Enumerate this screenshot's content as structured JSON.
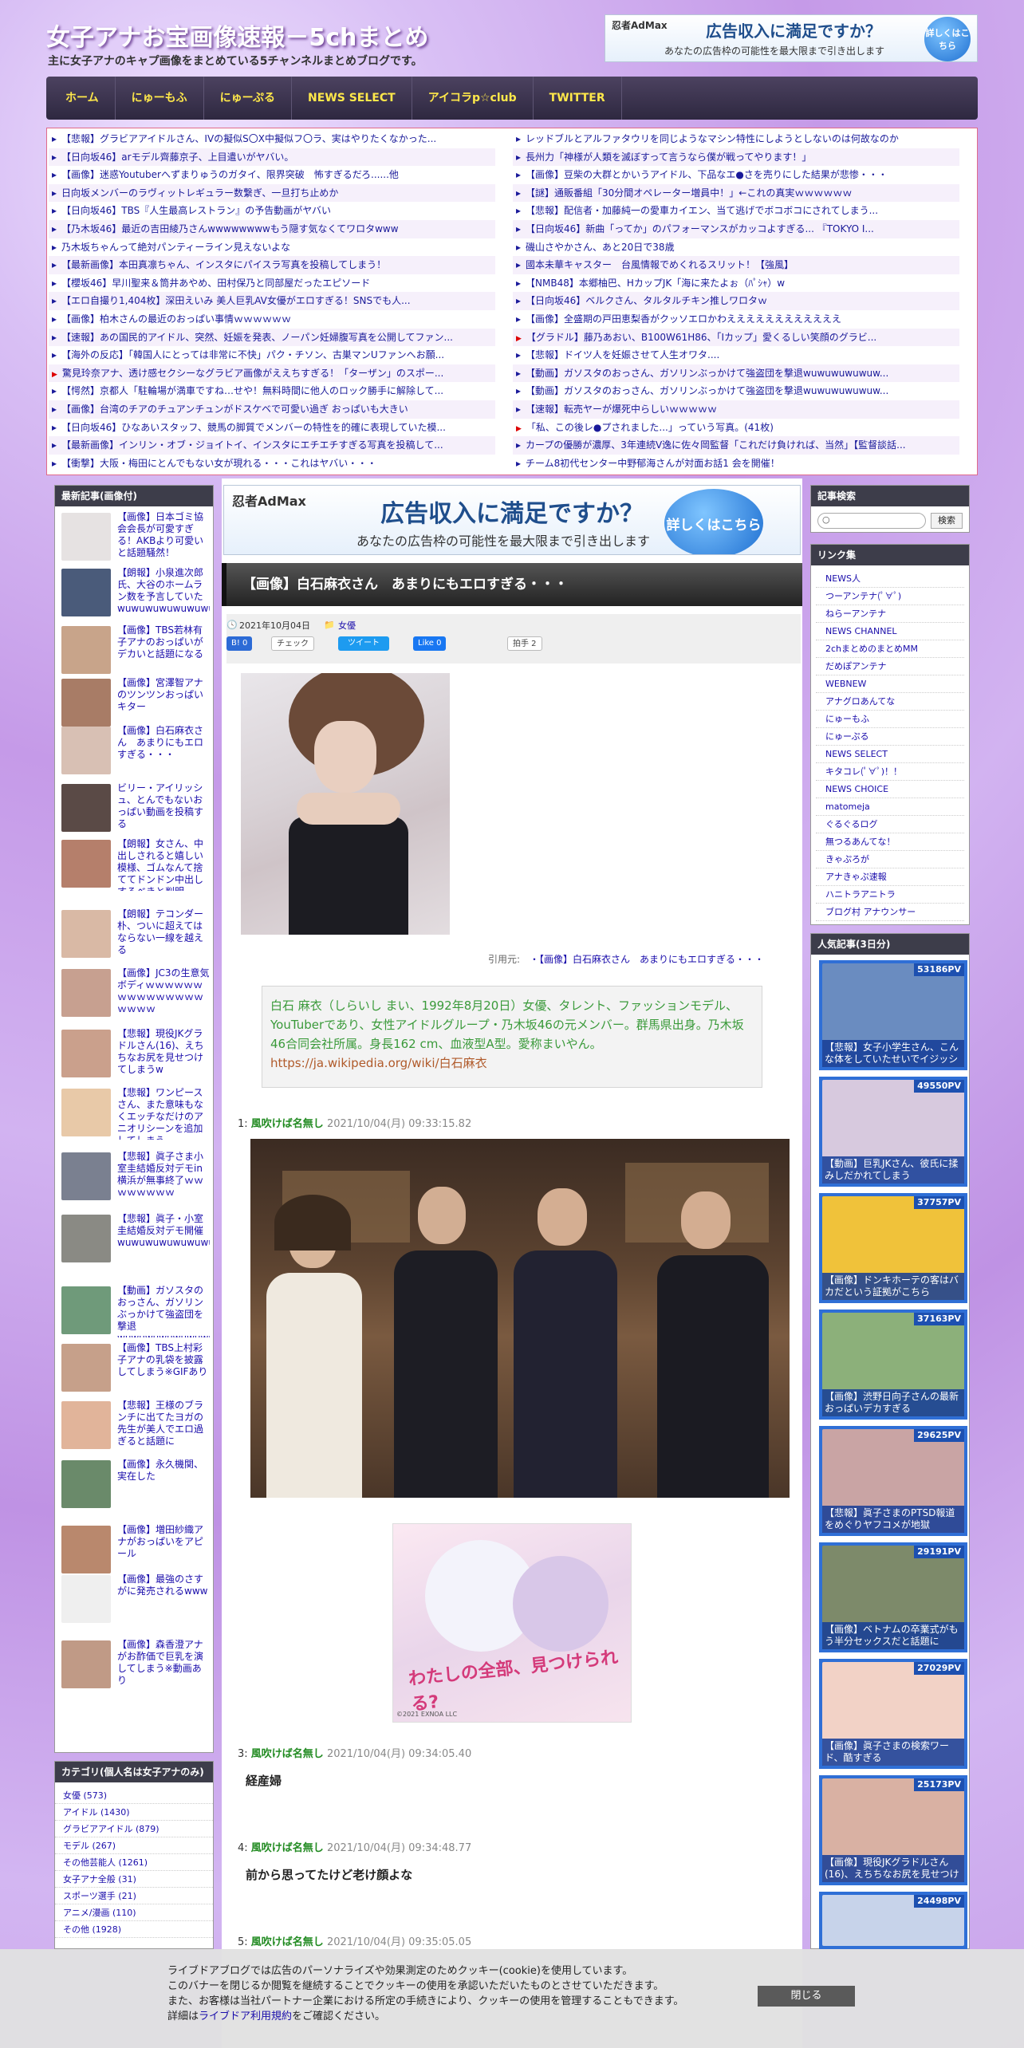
{
  "header": {
    "title": "女子アナお宝画像速報－5chまとめ",
    "subtitle": "主に女子アナのキャプ画像をまとめている5チャンネルまとめブログです。"
  },
  "ad_top": {
    "brand": "忍者AdMax",
    "headline": "広告収入に満足ですか？",
    "sub": "あなたの広告枠の可能性を最大限まで引き出します",
    "button": "詳しくはこちら"
  },
  "nav": [
    "ホーム",
    "にゅーもふ",
    "にゅーぷる",
    "NEWS SELECT",
    "アイコラp☆club",
    "TWITTER"
  ],
  "headlines_left": [
    "【悲報】グラビアアイドルさん、IVの擬似S〇X中擬似フ〇ラ、実はやりたくなかった...",
    "【日向坂46】arモデル齊藤京子、上目遣いがヤバい。",
    "【画像】迷惑Youtuberへずまりゅうのガタイ、限界突破　怖すぎるだろ......他",
    "日向坂メンバーのラヴィットレギュラー数繋ぎ、一旦打ち止めか",
    "【日向坂46】TBS『人生最高レストラン』の予告動画がヤバい",
    "【乃木坂46】最近の吉田綾乃さんwwwwwwwwもう隠す気なくてワロタwww",
    "乃木坂ちゃんって絶対パンティーライン見えないよな",
    "【最新画像】本田真凛ちゃん、インスタにパイスラ写真を投稿してしまう！",
    "【櫻坂46】早川聖来＆筒井あやめ、田村保乃と同部屋だったエピソード",
    "【エロ自撮り1,404枚】深田えいみ 美人巨乳AV女優がエロすぎる！SNSでも人...",
    "【画像】柏木さんの最近のおっぱい事情ｗｗｗｗｗｗ",
    "【速報】あの国民的アイドル、突然、妊娠を発表、ノーパン妊婦腹写真を公開してファン...",
    "【海外の反応】「韓国人にとっては非常に不快」パク・チソン、古巣マンUファンへお願...",
    "驚見玲奈アナ、透け感セクシーなグラビア画像がええちすぎる！「ターザン」のスポー...",
    "【愕然】京都人「駐輪場が満車ですね…せや！無料時間に他人のロック勝手に解除して...",
    "【画像】台湾のチアのチュアンチュンがドスケベで可愛い過ぎ おっぱいも大きい",
    "【日向坂46】ひなあいスタッフ、競馬の脚質でメンバーの特性を的確に表現していた模...",
    "【最新画像】インリン・オブ・ジョイトイ、インスタにエチエチすぎる写真を投稿して...",
    "【衝撃】大阪・梅田にとんでもない女が現れる・・・これはヤバい・・・"
  ],
  "headlines_right": [
    "レッドブルとアルファタウリを同じようなマシン特性にしようとしないのは何故なのか",
    "長州力「神様が人類を滅ぼすって言うなら僕が戦ってやります！」",
    "【画像】豆柴の大群とかいうアイドル、下品なエ●さを売りにした結果が悲惨・・・",
    "【謎】通販番組「30分間オペレーター増員中！」←これの真実ｗｗｗｗｗｗ",
    "【悲報】配信者・加藤純一の愛車カイエン、当て逃げでボコボコにされてしまう...",
    "【日向坂46】新曲「ってか」のパフォーマンスがカッコよすぎる... 『TOKYO I...",
    "磯山さやかさん、あと20日で38歳",
    "國本未華キャスター　台風情報でめくれるスリット！【強風】",
    "【NMB48】本郷柚巴、HカップJK「海に来たよぉ（ﾊﾟｼｬ）w",
    "【日向坂46】ベルクさん、タルタルチキン推しワロタｗ",
    "【画像】全盛期の戸田恵梨香がクッソエロかわええええええええええええ",
    "【グラドル】藤乃あおい、B100W61H86、「Iカップ」愛くるしい笑顔のグラビ...",
    "【悲報】ドイツ人を妊娠させて人生オワタ....",
    "【動画】ガソスタのおっさん、ガソリンぶっかけて強盗団を撃退wuwuwuwuwuw...",
    "【動画】ガソスタのおっさん、ガソリンぶっかけて強盗団を撃退wuwuwuwuwuw...",
    "【速報】転売ヤーが爆死中らしいｗｗｗｗｗ",
    "「私、この後レ●プされました...」っていう写真。(41枚)",
    "カープの優勝が濃厚、3年連続V逸に佐々岡監督「これだけ負ければ、当然」【監督談話...",
    "チーム8初代センター中野郁海さんが対面お話1 会を開催！"
  ],
  "sidebar_latest": {
    "heading": "最新記事(画像付)",
    "items": [
      "【画像】日本ゴミ協会会長が可愛すぎる！AKBより可愛いと話題騒然！",
      "【朗報】小泉進次郎氏、大谷のホームラン数を予言していたwuwuwuwuwuwuwu",
      "【画像】TBS若林有子アナのおっぱいがデカいと話題になる",
      "【画像】宮澤智アナのツンツンおっぱいキター",
      "【画像】白石麻衣さん　あまりにもエロすぎる・・・",
      "ビリー・アイリッシュ、とんでもないおっぱい動画を投稿する",
      "【朗報】女さん、中出しされると嬉しい模様、ゴムなんて捨ててドンドン中出しするべきと判明",
      "【朗報】テコンダー朴、ついに超えてはならない一線を越える",
      "【画像】JC3の生意気ボディｗｗｗｗｗｗｗｗｗｗｗｗｗｗｗｗｗｗｗ",
      "【悲報】現役JKグラドルさん(16)、えちちなお尻を見せつけてしまうw",
      "【悲報】ワンピースさん、また意味もなくエッチなだけのアニオリシーンを追加してしまう",
      "【悲報】眞子さま小室圭結婚反対デモin横浜が無事終了ｗｗｗｗｗｗｗｗ",
      "【悲報】眞子・小室圭結婚反対デモ開催wuwuwuwuwuwuwuwuwuwu",
      "【動画】ガソスタのおっさん、ガソリンぶっかけて強盗団を撃退wuwuwuwuwuwuwuwu",
      "【画像】TBS上村彩子アナの乳袋を披露してしまう※GIFあり",
      "【悲報】王様のブランチに出てたヨガの先生が美人でエロ過ぎると話題に",
      "【画像】永久機関、実在した",
      "【画像】増田紗織アナがおっぱいをアピール",
      "【画像】最強のさすがに発売されるwww",
      "【画像】森香澄アナがお酢価で巨乳を演してしまう※動画あり"
    ]
  },
  "sidebar_categories": {
    "heading": "カテゴリ(個人名は女子アナのみ)",
    "items": [
      "女優 (573)",
      "アイドル (1430)",
      "グラビアアイドル (879)",
      "モデル (267)",
      "その他芸能人 (1261)",
      "女子アナ全般 (31)",
      "スポーツ選手 (21)",
      "アニメ/漫画 (110)",
      "その他 (1928)"
    ]
  },
  "ad_main": {
    "brand": "忍者AdMax",
    "headline": "広告収入に満足ですか？",
    "sub": "あなたの広告枠の可能性を最大限まで引き出します",
    "button": "詳しくはこちら"
  },
  "article": {
    "title": "【画像】白石麻衣さん　あまりにもエロすぎる・・・",
    "date": "2021年10月04日",
    "category": "女優",
    "hatena": "B! 0",
    "check": "チェック",
    "tweet": "ツイート",
    "like": "Like 0",
    "clap": "拍手 2",
    "source_label": "引用元:",
    "source_link": "・【画像】白石麻衣さん　あまりにもエロすぎる・・・",
    "quote_text": "白石 麻衣（しらいし まい、1992年8月20日）女優、タレント、ファッションモデル、YouTuberであり、女性アイドルグループ・乃木坂46の元メンバー。群馬県出身。乃木坂46合同会社所属。身長162 cm、血液型A型。愛称まいやん。",
    "quote_link": "https://ja.wikipedia.org/wiki/白石麻衣",
    "ad_caption": "わたしの全部、見つけられる?",
    "ad_copy": "©2021 EXNOA LLC"
  },
  "comments": [
    {
      "num": "1:",
      "name": "風吹けば名無し",
      "date": "2021/10/04(月) 09:33:15.82",
      "body": ""
    },
    {
      "num": "3:",
      "name": "風吹けば名無し",
      "date": "2021/10/04(月) 09:34:05.40",
      "body": "経産婦"
    },
    {
      "num": "4:",
      "name": "風吹けば名無し",
      "date": "2021/10/04(月) 09:34:48.77",
      "body": "前から思ってたけど老け顔よな"
    },
    {
      "num": "5:",
      "name": "風吹けば名無し",
      "date": "2021/10/04(月) 09:35:05.05",
      "body": ""
    }
  ],
  "search": {
    "heading": "記事検索",
    "button": "検索",
    "placeholder": ""
  },
  "links": {
    "heading": "リンク集",
    "items": [
      "NEWS人",
      "つーアンテナ(ﾟ∀ﾟ)",
      "ねらーアンテナ",
      "NEWS CHANNEL",
      "2chまとめのまとめMM",
      "だめぽアンテナ",
      "WEBNEW",
      "アナグロあんてな",
      "にゅーもふ",
      "にゅーぷる",
      "NEWS SELECT",
      "キタコレ(ﾟ∀ﾟ)！！",
      "NEWS CHOICE",
      "matomeja",
      "ぐるぐるログ",
      "無つるあんてな！",
      "きゃぷろが",
      "アナきゃぷ速報",
      "ハニトラアニトラ",
      "ブログ村 アナウンサー"
    ]
  },
  "popular": {
    "heading": "人気記事(3日分)",
    "items": [
      {
        "pv": "53186PV",
        "title": "【悲報】女子小学生さん、こんな体をしていたせいでイジッシ"
      },
      {
        "pv": "49550PV",
        "title": "【動画】巨乳JKさん、彼氏に揉みしだかれてしまう"
      },
      {
        "pv": "37757PV",
        "title": "【画像】ドンキホーテの客はバカだという証拠がこちら"
      },
      {
        "pv": "37163PV",
        "title": "【画像】渋野日向子さんの最新おっぱいデカすぎる"
      },
      {
        "pv": "29625PV",
        "title": "【悲報】眞子さまのPTSD報道をめぐりヤフコメが地獄"
      },
      {
        "pv": "29191PV",
        "title": "【画像】ベトナムの卒業式がもう半分セックスだと話題に"
      },
      {
        "pv": "27029PV",
        "title": "【画像】眞子さまの検索ワード、酷すぎる"
      },
      {
        "pv": "25173PV",
        "title": "【画像】現役JKグラドルさん(16)、えちちなお尻を見せつけ"
      },
      {
        "pv": "24498PV",
        "title": ""
      }
    ]
  },
  "cookie": {
    "lines": [
      "ライブドアブログでは広告のパーソナライズや効果測定のためクッキー(cookie)を使用しています。",
      "このバナーを閉じるか閲覧を継続することでクッキーの使用を承認いただいたものとさせていただきます。",
      "また、お客様は当社パートナー企業における所定の手続きにより、クッキーの使用を管理することもできます。"
    ],
    "detail_prefix": "詳細は",
    "detail_link": "ライブドア利用規約",
    "detail_suffix": "をご確認ください。",
    "close": "閉じる"
  }
}
